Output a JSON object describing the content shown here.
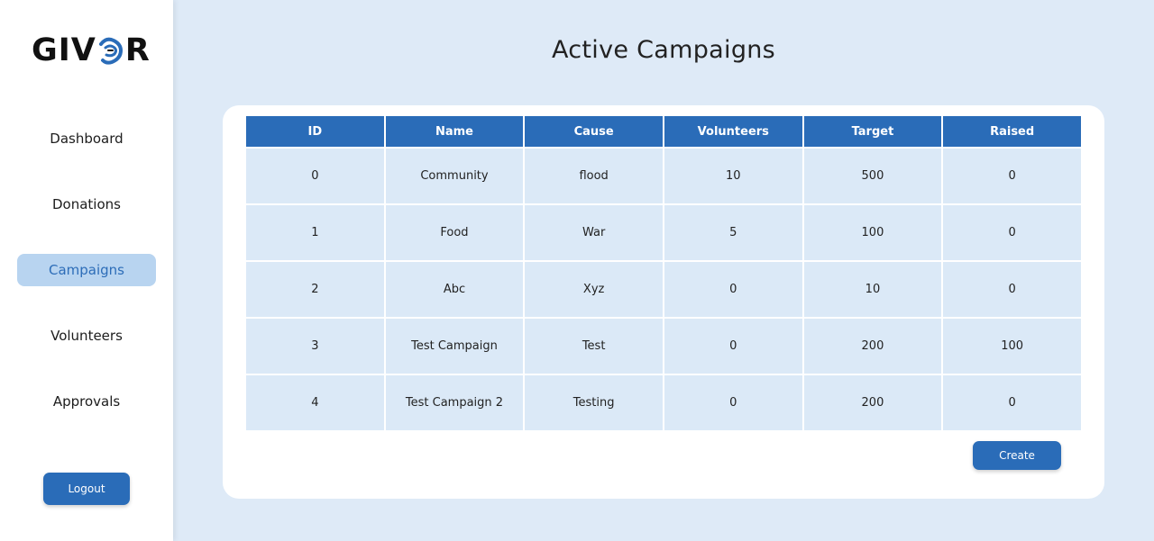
{
  "brand": {
    "logo_left": "GIV",
    "logo_right": "R",
    "accent": "#2a6cb8"
  },
  "sidebar": {
    "items": [
      {
        "label": "Dashboard",
        "active": false
      },
      {
        "label": "Donations",
        "active": false
      },
      {
        "label": "Campaigns",
        "active": true
      },
      {
        "label": "Volunteers",
        "active": false
      },
      {
        "label": "Approvals",
        "active": false
      }
    ],
    "logout_label": "Logout"
  },
  "main": {
    "title": "Active Campaigns",
    "table": {
      "headers": [
        "ID",
        "Name",
        "Cause",
        "Volunteers",
        "Target",
        "Raised"
      ],
      "rows": [
        [
          "0",
          "Community",
          "flood",
          "10",
          "500",
          "0"
        ],
        [
          "1",
          "Food",
          "War",
          "5",
          "100",
          "0"
        ],
        [
          "2",
          "Abc",
          "Xyz",
          "0",
          "10",
          "0"
        ],
        [
          "3",
          "Test Campaign",
          "Test",
          "0",
          "200",
          "100"
        ],
        [
          "4",
          "Test Campaign 2",
          "Testing",
          "0",
          "200",
          "0"
        ]
      ]
    },
    "create_label": "Create"
  }
}
